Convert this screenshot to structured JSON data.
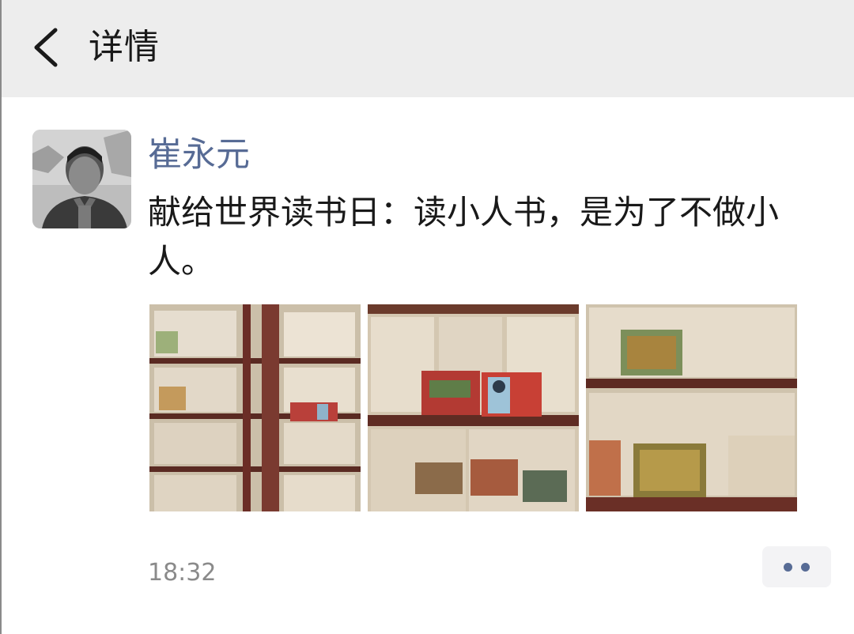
{
  "header": {
    "back_icon": "chevron-left-icon",
    "title": "详情"
  },
  "post": {
    "author": "崔永元",
    "text": "献给世界读书日：读小人书，是为了不做小人。",
    "photo_count": 3,
    "time": "18:32",
    "more_icon": "two-dots-icon"
  },
  "colors": {
    "header_bg": "#ededed",
    "name_link": "#576b95",
    "timestamp": "#8a8a8a",
    "text": "#191919"
  }
}
